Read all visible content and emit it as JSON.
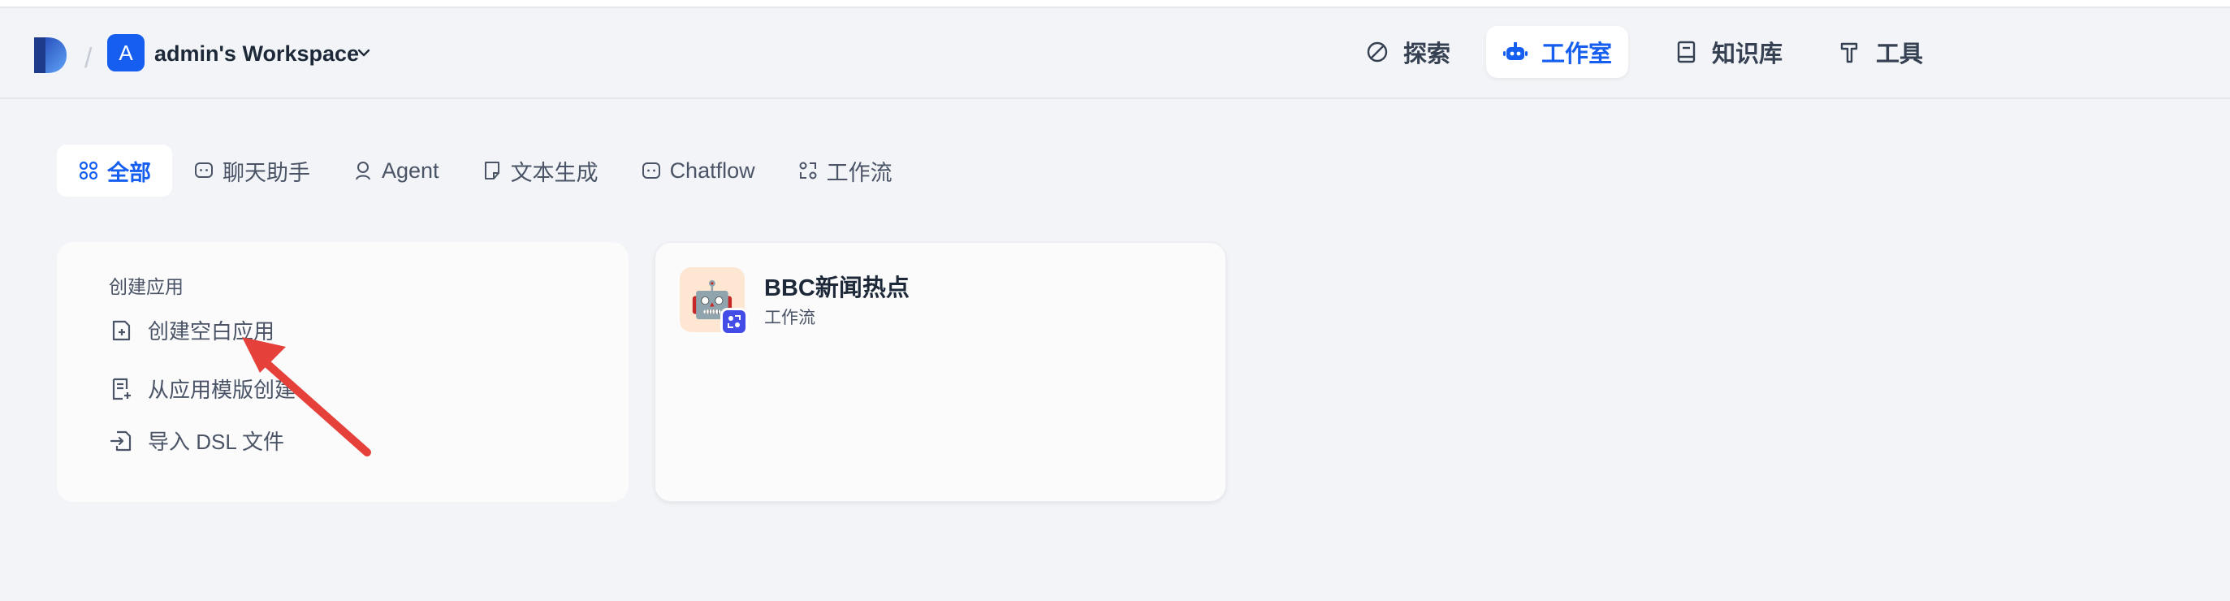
{
  "workspace": {
    "avatar_letter": "A",
    "name": "admin's Workspace"
  },
  "nav": [
    {
      "label": "探索",
      "icon": "compass-icon",
      "active": false
    },
    {
      "label": "工作室",
      "icon": "robot-icon",
      "active": true
    },
    {
      "label": "知识库",
      "icon": "book-icon",
      "active": false
    },
    {
      "label": "工具",
      "icon": "hammer-icon",
      "active": false
    }
  ],
  "tabs": [
    {
      "label": "全部",
      "icon": "grid-icon",
      "active": true
    },
    {
      "label": "聊天助手",
      "icon": "chat-bubble-icon",
      "active": false
    },
    {
      "label": "Agent",
      "icon": "agent-icon",
      "active": false
    },
    {
      "label": "文本生成",
      "icon": "document-icon",
      "active": false
    },
    {
      "label": "Chatflow",
      "icon": "chatflow-icon",
      "active": false
    },
    {
      "label": "工作流",
      "icon": "workflow-icon",
      "active": false
    }
  ],
  "create_card": {
    "title": "创建应用",
    "items": [
      {
        "label": "创建空白应用",
        "icon": "file-plus-icon"
      },
      {
        "label": "从应用模版创建",
        "icon": "file-template-icon"
      },
      {
        "label": "导入 DSL 文件",
        "icon": "file-import-icon"
      }
    ]
  },
  "apps": [
    {
      "name": "BBC新闻热点",
      "type": "工作流",
      "icon_emoji": "🤖",
      "icon_bg": "#fde7d3",
      "badge": "workflow-badge-icon"
    }
  ],
  "colors": {
    "accent": "#155eef",
    "background": "#f2f4f7",
    "annotation_arrow": "#e5403a"
  }
}
